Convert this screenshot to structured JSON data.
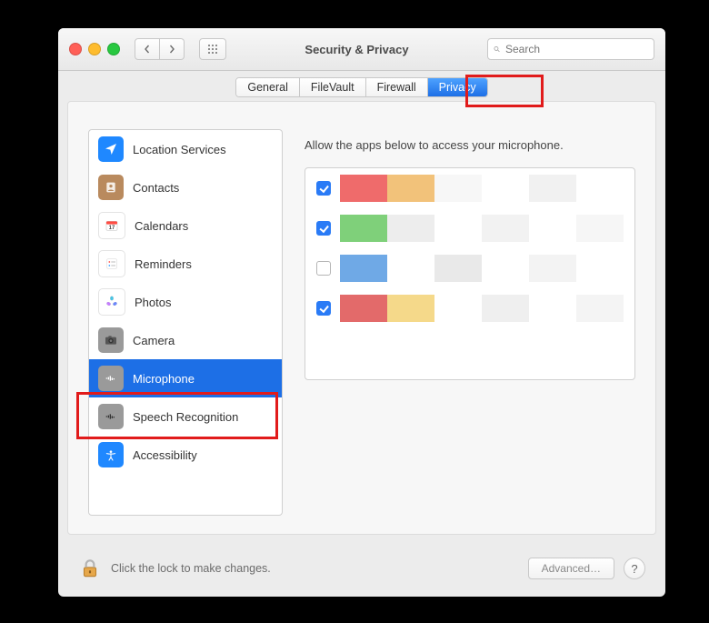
{
  "window": {
    "title": "Security & Privacy",
    "search_placeholder": "Search"
  },
  "tabs": [
    {
      "label": "General",
      "active": false
    },
    {
      "label": "FileVault",
      "active": false
    },
    {
      "label": "Firewall",
      "active": false
    },
    {
      "label": "Privacy",
      "active": true
    }
  ],
  "categories": [
    {
      "label": "Location Services",
      "icon": "location",
      "bg": "#1f88ff",
      "selected": false
    },
    {
      "label": "Contacts",
      "icon": "contacts",
      "bg": "#b98a5e",
      "selected": false
    },
    {
      "label": "Calendars",
      "icon": "calendar",
      "bg": "#ffffff",
      "selected": false
    },
    {
      "label": "Reminders",
      "icon": "reminders",
      "bg": "#ffffff",
      "selected": false
    },
    {
      "label": "Photos",
      "icon": "photos",
      "bg": "#ffffff",
      "selected": false
    },
    {
      "label": "Camera",
      "icon": "camera",
      "bg": "#9a9a9a",
      "selected": false
    },
    {
      "label": "Microphone",
      "icon": "microphone",
      "bg": "#9a9a9a",
      "selected": true
    },
    {
      "label": "Speech Recognition",
      "icon": "microphone",
      "bg": "#9a9a9a",
      "selected": false
    },
    {
      "label": "Accessibility",
      "icon": "accessibility",
      "bg": "#1f88ff",
      "selected": false
    }
  ],
  "panel": {
    "heading": "Allow the apps below to access your microphone.",
    "apps": [
      {
        "checked": true
      },
      {
        "checked": true
      },
      {
        "checked": false
      },
      {
        "checked": true
      }
    ]
  },
  "footer": {
    "lock_text": "Click the lock to make changes.",
    "advanced_label": "Advanced…"
  },
  "highlights": [
    "privacy-tab",
    "microphone-category"
  ]
}
